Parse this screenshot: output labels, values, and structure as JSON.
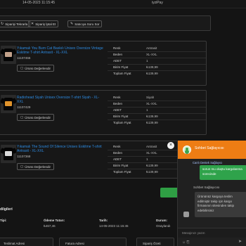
{
  "header": {
    "date": "14-05-2023 11:15:45",
    "payment": "iyziPay"
  },
  "actions": [
    {
      "label": "Siparişi Tekrarla",
      "icon": "↻"
    },
    {
      "label": "Sipariş İptal Et",
      "icon": "✕"
    },
    {
      "label": "Satıcıya Soru Sor",
      "icon": "✎"
    }
  ],
  "items": [
    {
      "title": "Yıkamalı You Burn Cat Baskılı Unisex Oversize Vintage Eskitme T-shirt Antrasit - XL-XXL",
      "sku": "11107466",
      "rate_label": "Ürünü Değerlendir",
      "print_color": "#c2a18a",
      "fields": [
        {
          "label": "Renk",
          "value": "Antrasit"
        },
        {
          "label": "Beden",
          "value": "XL-XXL"
        },
        {
          "label": "ADET",
          "value": "1"
        },
        {
          "label": "Birim Fiyat",
          "value": "₺139,99"
        },
        {
          "label": "Toplam Fiyat",
          "value": "₺139,99"
        }
      ]
    },
    {
      "title": "Radiohead Siyah Unisex Oversize T-shirt Siyah - XL-XXL",
      "sku": "11107429",
      "rate_label": "Ürünü Değerlendir",
      "print_color": "#e0932b",
      "fields": [
        {
          "label": "Renk",
          "value": "Siyah"
        },
        {
          "label": "Beden",
          "value": "XL-XXL"
        },
        {
          "label": "ADET",
          "value": "1"
        },
        {
          "label": "Birim Fiyat",
          "value": "₺139,99"
        },
        {
          "label": "Toplam Fiyat",
          "value": "₺139,99"
        }
      ]
    },
    {
      "title": "Yıkamalı The Sound Of Silence Unisex Eskitme T-shirt Antrasit - XL-XXL",
      "sku": "11107368",
      "rate_label": "Ürünü Değerlendir",
      "print_color": "#dadada",
      "fields": [
        {
          "label": "Renk",
          "value": "Antrasit"
        },
        {
          "label": "Beden",
          "value": "XL-XXL"
        },
        {
          "label": "ADET",
          "value": "1"
        },
        {
          "label": "Birim Fiyat",
          "value": "₺139,99"
        },
        {
          "label": "Toplam Fiyat",
          "value": "₺139,99"
        }
      ]
    }
  ],
  "summary": {
    "title": "dilgileri",
    "headers": [
      "Tipi:",
      "Ödeme Tutarı:",
      "Tarih:",
      "Durum:"
    ],
    "values": [
      "",
      "₺467,46",
      "14-05-2023 11:15:45",
      "Onaylandı"
    ],
    "address_boxes": [
      "Teslimat Adresi",
      "Fatura Adresi",
      "Sipariş Özeti"
    ]
  },
  "chat": {
    "header_name": "Sohbet Sağlayıcısı",
    "agent_line": "Canlı Destek Sağlayıcı",
    "incoming": "sorun mu oluştu kargolanma sürecinde",
    "sender2": "Sohbet Sağlayıcısı",
    "outgoing": "Ürününüz kargoya teslim edilmiştir takip için kargo firmasının sitesinden takip edebilirsiniz",
    "input_placeholder": "Mesajınızı yazın",
    "send_icon": "➤"
  },
  "colors": {
    "accent": "#ee7d14",
    "link": "#2d8ae0",
    "green": "#2f9e44"
  }
}
